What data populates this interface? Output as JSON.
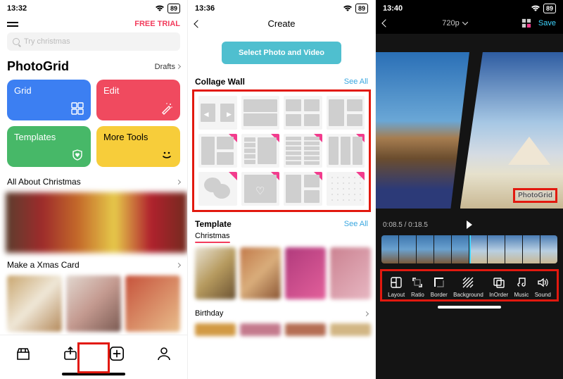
{
  "screen1": {
    "status": {
      "time": "13:32",
      "battery": "89"
    },
    "free_trial": "FREE TRIAL",
    "search": {
      "placeholder": "Try christmas"
    },
    "brand": "PhotoGrid",
    "drafts": "Drafts",
    "tiles": {
      "grid": "Grid",
      "edit": "Edit",
      "templates": "Templates",
      "tools": "More Tools"
    },
    "section_christmas": "All About Christmas",
    "section_xmas_card": "Make a Xmas Card"
  },
  "screen2": {
    "status": {
      "time": "13:36",
      "battery": "89"
    },
    "title": "Create",
    "primary_btn": "Select Photo and Video",
    "collage": {
      "title": "Collage Wall",
      "see_all": "See All"
    },
    "template": {
      "title": "Template",
      "see_all": "See All",
      "tabs": [
        "Christmas"
      ]
    },
    "birthday": "Birthday"
  },
  "screen3": {
    "status": {
      "time": "13:40",
      "battery": "89"
    },
    "resolution": "720p",
    "save": "Save",
    "watermark": "PhotoGrid",
    "time": {
      "current": "0:08.5",
      "total": "0:18.5"
    },
    "tools": {
      "layout": "Layout",
      "ratio": "Ratio",
      "border": "Border",
      "background": "Background",
      "inorder": "InOrder",
      "music": "Music",
      "sound": "Sound"
    }
  }
}
